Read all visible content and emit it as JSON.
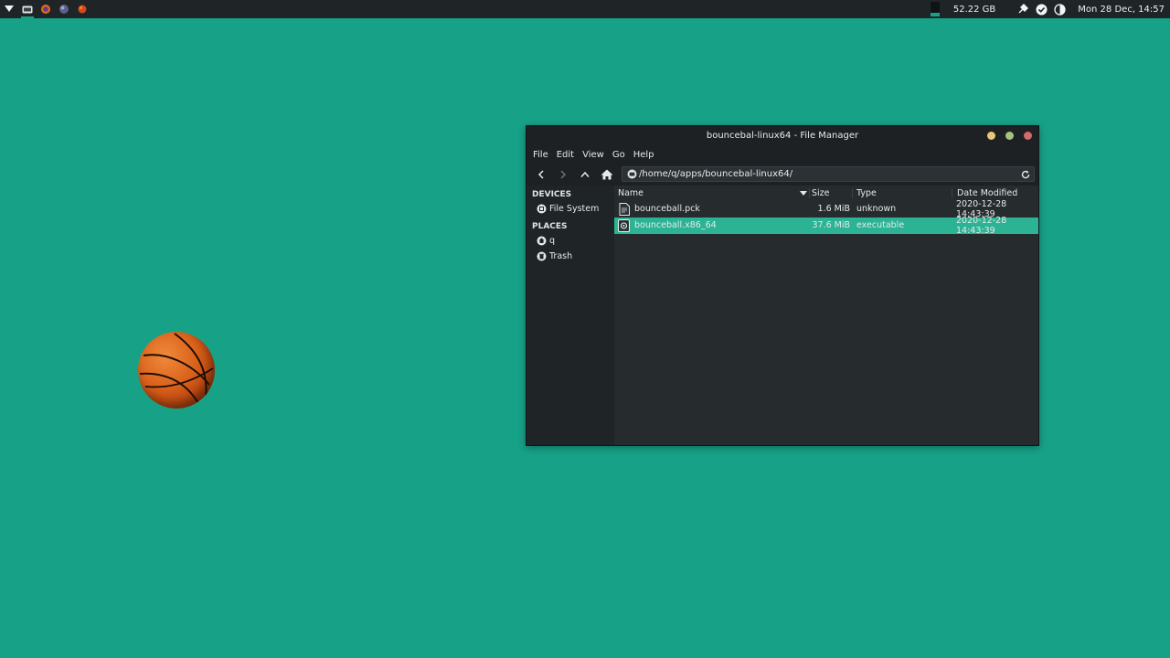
{
  "panel": {
    "disk_usage": "52.22 GB",
    "clock": "Mon 28 Dec, 14:57"
  },
  "window": {
    "title": "bouncebal-linux64 - File Manager",
    "menu": [
      "File",
      "Edit",
      "View",
      "Go",
      "Help"
    ],
    "location": "/home/q/apps/bouncebal-linux64/",
    "sidebar": {
      "devices_header": "DEVICES",
      "devices": [
        {
          "label": "File System",
          "icon": "drive-icon"
        }
      ],
      "places_header": "PLACES",
      "places": [
        {
          "label": "q",
          "icon": "home-icon"
        },
        {
          "label": "Trash",
          "icon": "trash-icon"
        }
      ]
    },
    "columns": {
      "name": "Name",
      "size": "Size",
      "type": "Type",
      "date": "Date Modified"
    },
    "files": [
      {
        "name": "bounceball.pck",
        "size": "1.6 MiB",
        "type": "unknown",
        "date": "2020-12-28 14:43:39",
        "selected": false
      },
      {
        "name": "bounceball.x86_64",
        "size": "37.6 MiB",
        "type": "executable",
        "date": "2020-12-28 14:43:39",
        "selected": true
      }
    ]
  },
  "colors": {
    "desktop": "#17a287",
    "selection": "#2bb394",
    "window_bg": "#262b2e",
    "panel_bg": "#1f2427"
  }
}
